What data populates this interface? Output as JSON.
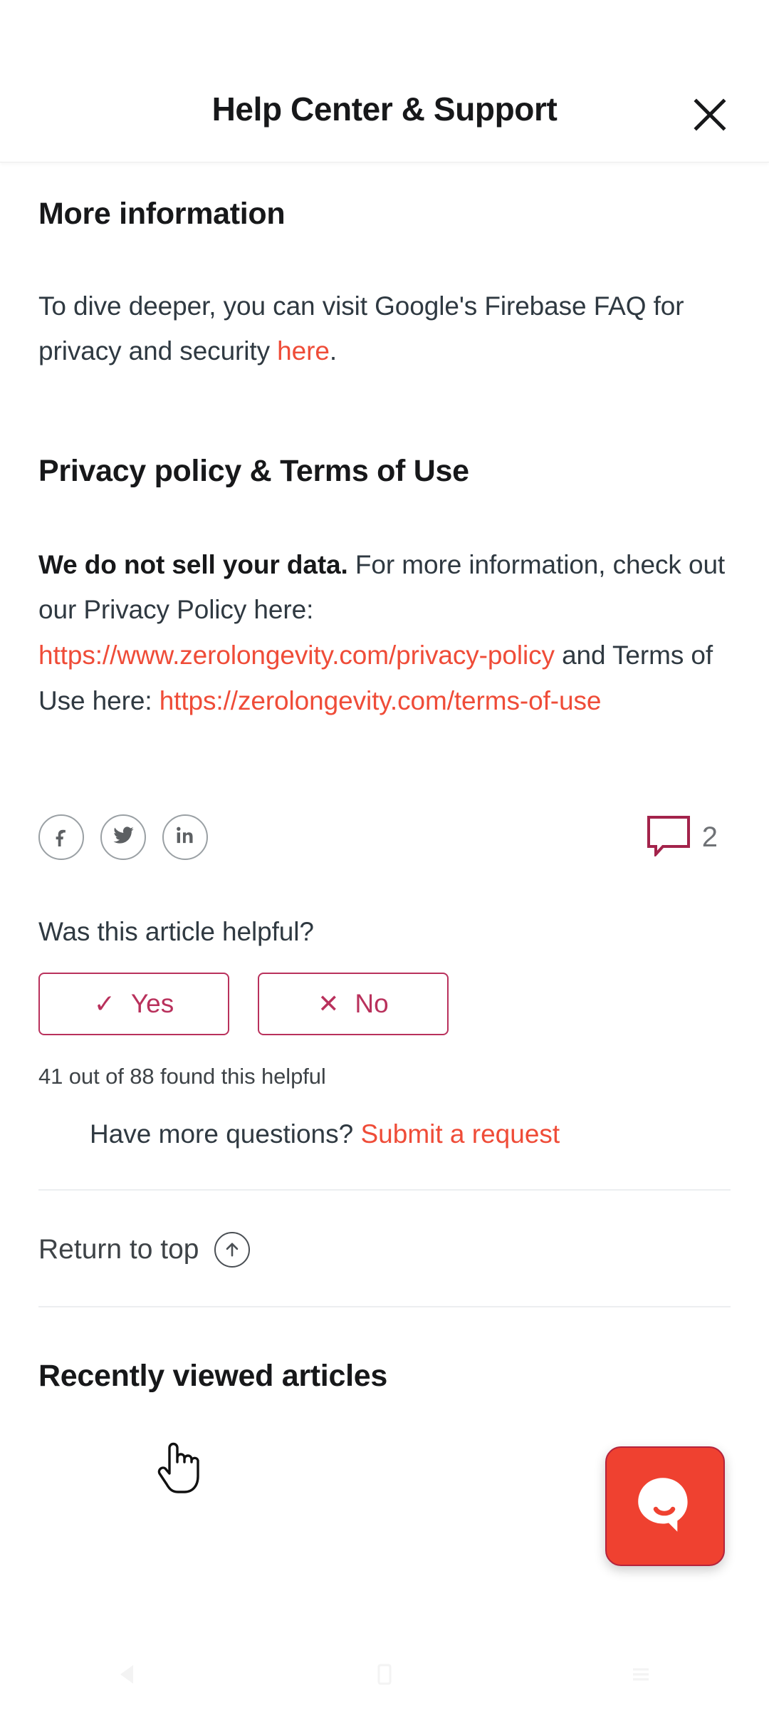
{
  "status_bar": {
    "recording_indicator_icon": "video-record-icon"
  },
  "header": {
    "title": "Help Center & Support",
    "close_icon": "close-icon"
  },
  "article": {
    "sections": [
      {
        "heading": "More information",
        "paragraph_prefix": "To dive deeper, you can visit Google's Firebase FAQ for privacy and security ",
        "link_text": "here",
        "paragraph_suffix": "."
      },
      {
        "heading": "Privacy policy & Terms of Use",
        "bold_lead": "We do not sell your data.",
        "text_1": " For more information, check out our Privacy Policy here: ",
        "link_1": "https://www.zerolongevity.com/privacy-policy",
        "text_2": " and Terms of Use here: ",
        "link_2": "https://zerolongevity.com/terms-of-use"
      }
    ]
  },
  "share": {
    "facebook_icon": "facebook-icon",
    "twitter_icon": "twitter-icon",
    "linkedin_icon": "linkedin-icon",
    "comment_icon": "comment-bubble-icon",
    "comment_count": "2"
  },
  "feedback": {
    "question": "Was this article helpful?",
    "yes_label": "Yes",
    "yes_glyph": "✓",
    "no_label": "No",
    "no_glyph": "✕",
    "vote_count_text": "41 out of 88 found this helpful"
  },
  "request": {
    "prompt": "Have more questions?",
    "link_text": "Submit a request"
  },
  "footer": {
    "return_to_top": "Return to top",
    "return_icon": "arrow-up-circle-icon",
    "next_heading": "Recently viewed articles"
  },
  "chat": {
    "launcher_icon": "chat-smile-icon"
  },
  "nav_bar": {
    "back_icon": "back-triangle-icon",
    "home_icon": "home-square-icon",
    "recents_icon": "recents-lines-icon"
  },
  "cursor": {
    "pointer_icon": "hand-pointer-cursor"
  },
  "colors": {
    "link_red": "#ef4c38",
    "vote_border": "#b9315c",
    "chat_red": "#ef4130",
    "recording_red": "#f0402c"
  }
}
